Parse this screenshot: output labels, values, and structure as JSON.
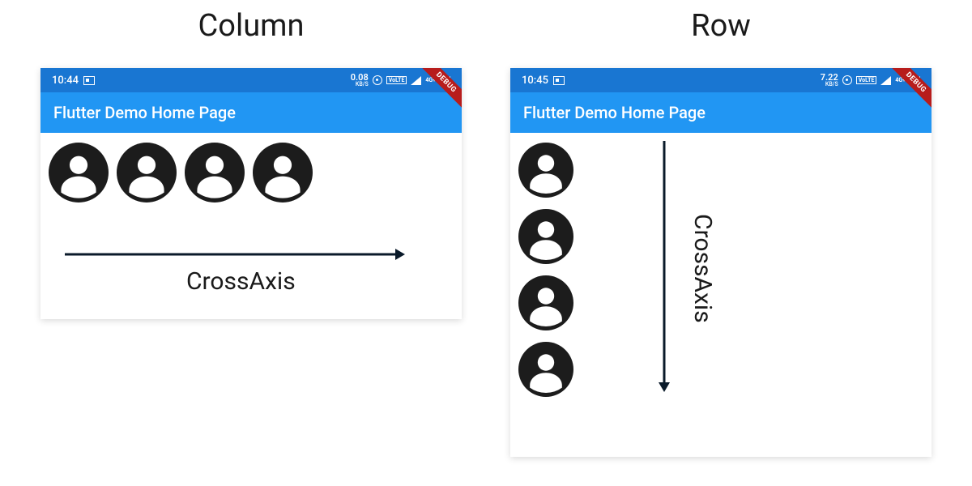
{
  "left": {
    "title": "Column",
    "statusTime": "10:44",
    "dataRate": "0.08",
    "dataUnit": "KB/S",
    "volte": "VoLTE",
    "sig4g": "4G+",
    "debug": "DEBUG",
    "appBarTitle": "Flutter Demo Home Page",
    "axisLabel": "CrossAxis"
  },
  "right": {
    "title": "Row",
    "statusTime": "10:45",
    "dataRate": "7.22",
    "dataUnit": "KB/S",
    "volte": "VoLTE",
    "sig4g": "4G+",
    "debug": "DEBUG",
    "appBarTitle": "Flutter Demo Home Page",
    "axisLabel": "CrossAxis"
  }
}
